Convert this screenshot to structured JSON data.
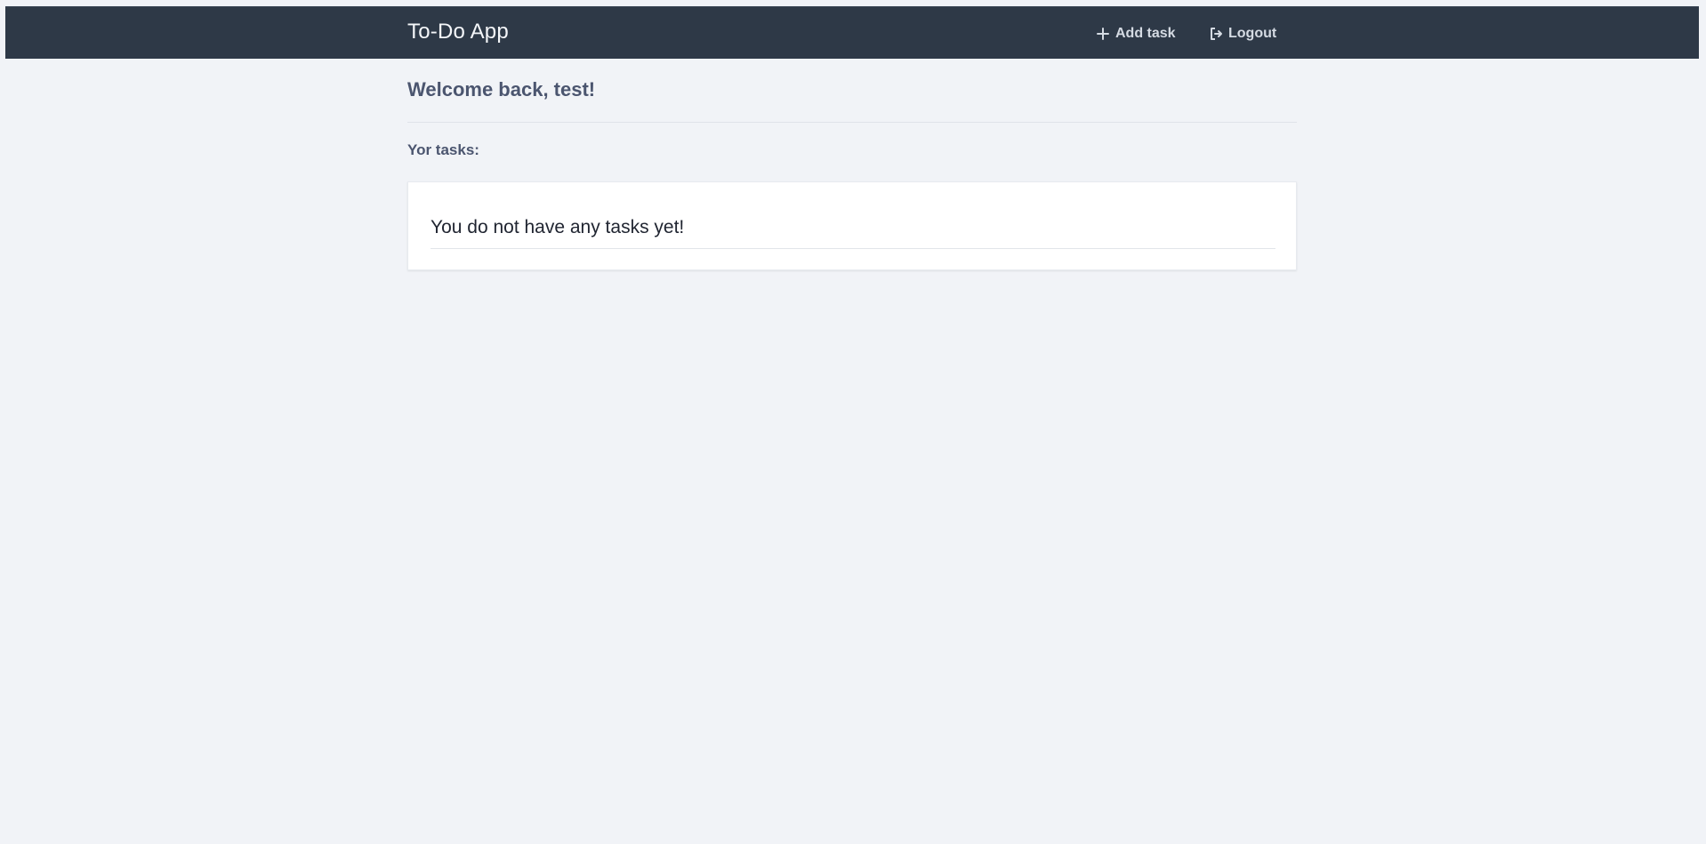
{
  "navbar": {
    "brand": "To-Do App",
    "add_task": {
      "label": "Add task",
      "icon": "plus-icon"
    },
    "logout": {
      "label": "Logout",
      "icon": "sign-out-icon"
    }
  },
  "main": {
    "welcome": "Welcome back, test!",
    "tasks_heading": "Yor tasks:",
    "empty_message": "You do not have any tasks yet!"
  },
  "colors": {
    "navbar_bg": "#2e3947",
    "page_bg": "#f1f3f7",
    "heading_text": "#4b556f",
    "card_bg": "#ffffff"
  }
}
